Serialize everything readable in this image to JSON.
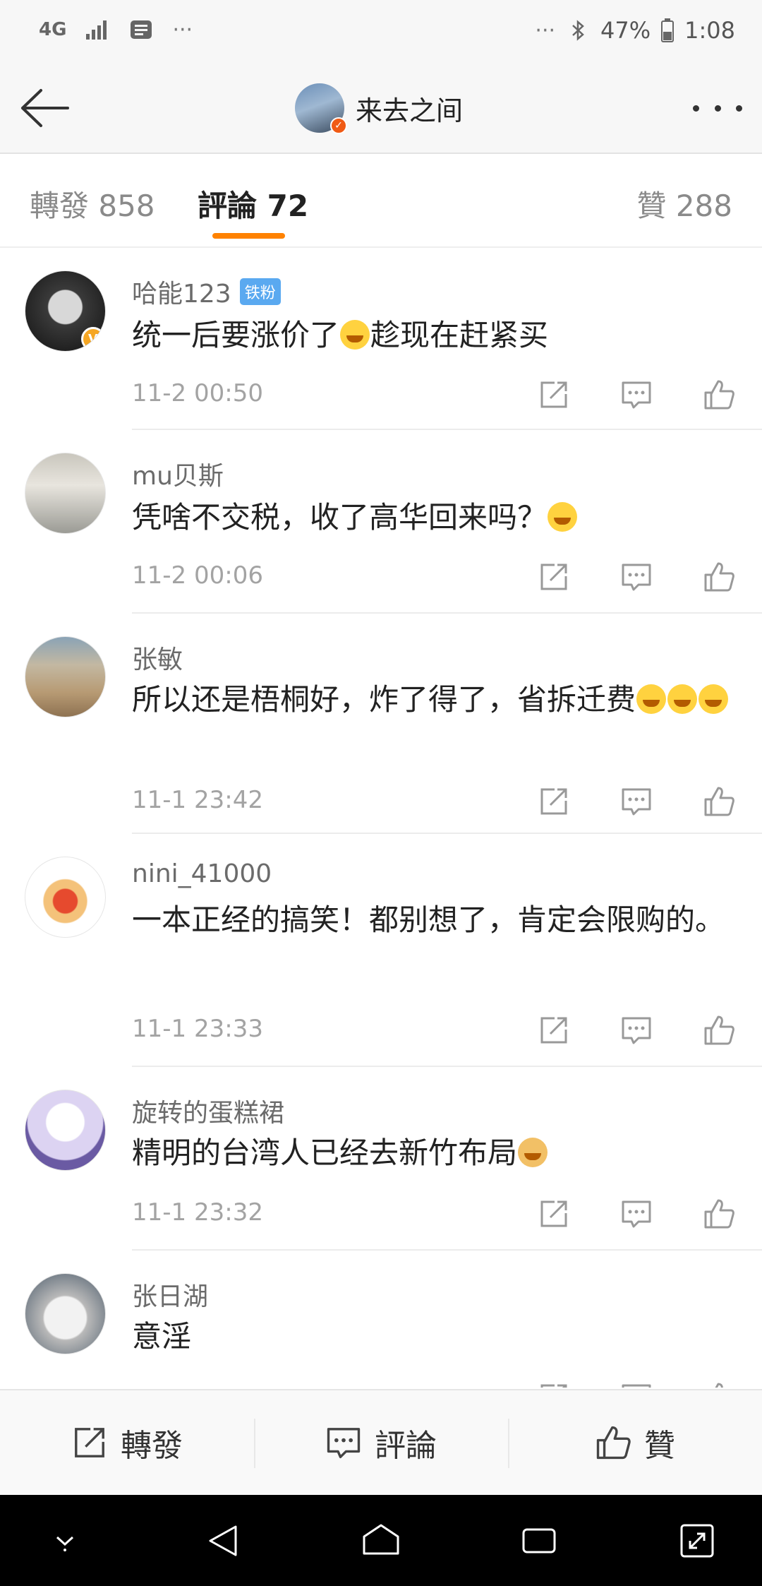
{
  "status_bar": {
    "network": "4G",
    "dots_left": "···",
    "dots_right": "···",
    "battery": "47%",
    "time": "1:08"
  },
  "nav": {
    "title": "来去之间"
  },
  "tabs": {
    "repost": "轉發 858",
    "comments": "評論 72",
    "likes": "贊 288"
  },
  "comments": [
    {
      "name": "哈能123",
      "badge": "铁粉",
      "text_before": "统一后要涨价了",
      "text_after": "趁现在赶紧买",
      "time": "11-2 00:50"
    },
    {
      "name": "mu贝斯",
      "text_before": "凭啥不交税，收了高华回来吗？",
      "text_after": "",
      "time": "11-2 00:06"
    },
    {
      "name": "张敏",
      "text_before": "所以还是梧桐好，炸了得了，省拆迁费",
      "text_after": "",
      "time": "11-1 23:42"
    },
    {
      "name": "nini_41000",
      "text_before": "一本正经的搞笑！都别想了，肯定会限购的。",
      "text_after": "",
      "time": "11-1 23:33"
    },
    {
      "name": "旋转的蛋糕裙",
      "text_before": "精明的台湾人已经去新竹布局",
      "text_after": "",
      "time": "11-1 23:32"
    },
    {
      "name": "张日湖",
      "text_before": "意淫",
      "text_after": "",
      "time": ""
    }
  ],
  "toolbar": {
    "repost": "轉發",
    "comment": "評論",
    "like": "贊"
  },
  "colors": {
    "accent": "#ff8200",
    "verified": "#f5a623",
    "fan_badge": "#5aa9f0"
  }
}
